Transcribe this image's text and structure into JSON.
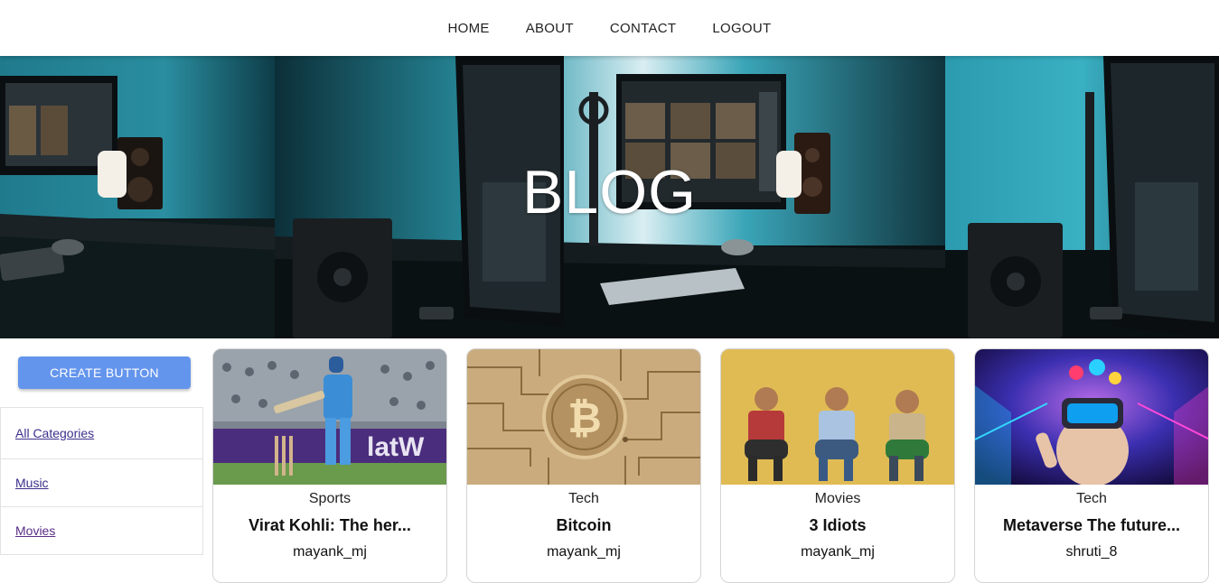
{
  "nav": {
    "items": [
      {
        "label": "HOME"
      },
      {
        "label": "ABOUT"
      },
      {
        "label": "CONTACT"
      },
      {
        "label": "LOGOUT"
      }
    ]
  },
  "banner": {
    "title": "BLOG"
  },
  "sidebar": {
    "create_label": "CREATE BUTTON",
    "categories": [
      {
        "label": "All Categories"
      },
      {
        "label": "Music"
      },
      {
        "label": "Movies"
      }
    ]
  },
  "posts": [
    {
      "category": "Sports",
      "title": "Virat Kohli: The her...",
      "author": "mayank_mj",
      "image": "cricket-batsman-image"
    },
    {
      "category": "Tech",
      "title": "Bitcoin",
      "author": "mayank_mj",
      "image": "bitcoin-circuit-image"
    },
    {
      "category": "Movies",
      "title": "3 Idiots",
      "author": "mayank_mj",
      "image": "three-idiots-poster-image"
    },
    {
      "category": "Tech",
      "title": "Metaverse The future...",
      "author": "shruti_8",
      "image": "vr-headset-neon-image"
    }
  ],
  "colors": {
    "create_button": "#6495ed",
    "link": "#3c2f8c",
    "banner_teal": "#1c6f82"
  }
}
